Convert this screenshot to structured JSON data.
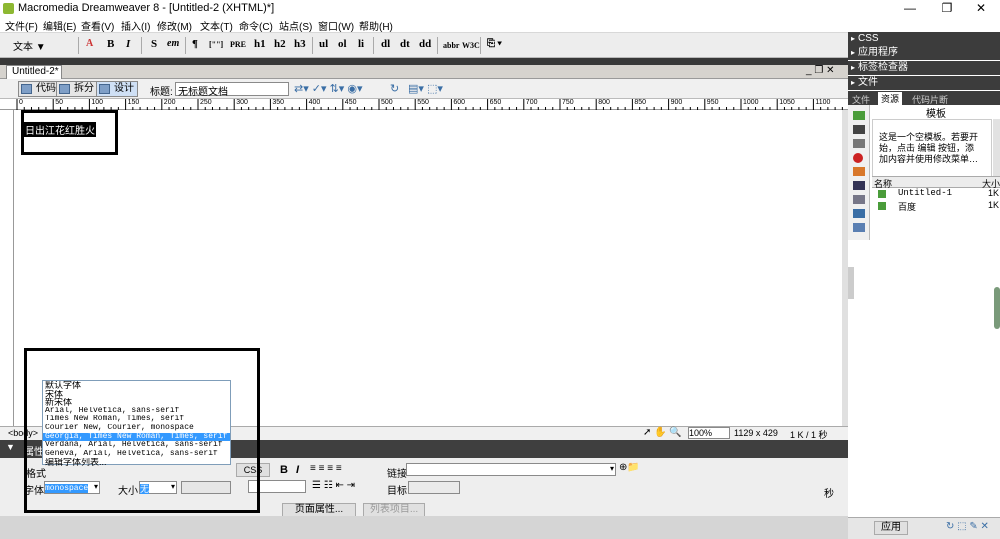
{
  "window": {
    "title": "Macromedia Dreamweaver 8 - [Untitled-2 (XHTML)*]",
    "minimize": "—",
    "maximize": "❐",
    "close": "✕"
  },
  "menu": [
    "文件(F)",
    "编辑(E)",
    "查看(V)",
    "插入(I)",
    "修改(M)",
    "文本(T)",
    "命令(C)",
    "站点(S)",
    "窗口(W)",
    "帮助(H)"
  ],
  "toolbar": {
    "category": "文本 ▼",
    "buttons": [
      "B",
      "I",
      "S",
      "em",
      "¶",
      "[\"\"]",
      "PRE",
      "h1",
      "h2",
      "h3",
      "ul",
      "ol",
      "li",
      "dl",
      "dt",
      "dd",
      "abbr",
      "W3C"
    ]
  },
  "document": {
    "tab": "Untitled-2*",
    "view_code": "代码",
    "view_split": "拆分",
    "view_design": "设计",
    "title_label": "标题:",
    "title_value": "无标题文档",
    "canvas_text": "日出江花红胜火",
    "ruler_marks": [
      "0",
      "50",
      "100",
      "150",
      "200",
      "250",
      "300",
      "350",
      "400",
      "450",
      "500",
      "550",
      "600",
      "650",
      "700",
      "750",
      "800",
      "850",
      "900",
      "950",
      "1000",
      "1050",
      "1100"
    ]
  },
  "status": {
    "tag": "<body>",
    "zoom": "100%",
    "size": "1129 x 429",
    "file": "1 K / 1 秒"
  },
  "properties": {
    "header": "属性",
    "format_label": "格式",
    "font_label": "字体",
    "font_value": "monospace",
    "size_label": "大小",
    "size_value": "无",
    "css_button": "CSS",
    "bold": "B",
    "italic": "I",
    "link_label": "链接",
    "target_label": "目标",
    "page_props": "页面属性...",
    "list_item": "列表项目...",
    "seconds": "秒"
  },
  "font_dropdown": {
    "options": [
      "默认字体",
      "宋体",
      "新宋体",
      "Arial, Helvetica, sans-serif",
      "Times New Roman, Times, serif",
      "Courier New, Courier, monospace",
      "Georgia, Times New Roman, Times, serif",
      "Verdana, Arial, Helvetica, sans-serif",
      "Geneva, Arial, Helvetica, sans-serif",
      "编辑字体列表..."
    ],
    "selected_index": 6
  },
  "right_panel": {
    "headers": [
      "CSS",
      "应用程序",
      "标签检查器",
      "文件"
    ],
    "tabs": [
      "文件",
      "资源",
      "代码片断"
    ],
    "section_title": "模板",
    "description": "这是一个空模板。若要开始，点击 编辑 按钮，添加内容并使用修改菜单…",
    "col_name": "名称",
    "col_size": "大小",
    "files": [
      {
        "name": "Untitled-1",
        "size": "1K"
      },
      {
        "name": "百度",
        "size": "1K"
      }
    ],
    "apply_button": "应用"
  }
}
